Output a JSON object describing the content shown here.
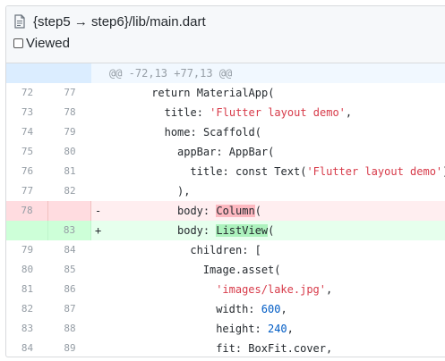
{
  "file": {
    "path": "{step5 → step6}/lib/main.dart",
    "viewed_label": "Viewed"
  },
  "hunk_header": "@@ -72,13 +77,13 @@",
  "lines": [
    {
      "type": "ctx",
      "old": "72",
      "new": "77",
      "sign": "",
      "code": "return MaterialApp(",
      "indent": 6
    },
    {
      "type": "ctx",
      "old": "73",
      "new": "78",
      "sign": "",
      "code": "title: 'Flutter layout demo',",
      "indent": 8
    },
    {
      "type": "ctx",
      "old": "74",
      "new": "79",
      "sign": "",
      "code": "home: Scaffold(",
      "indent": 8
    },
    {
      "type": "ctx",
      "old": "75",
      "new": "80",
      "sign": "",
      "code": "appBar: AppBar(",
      "indent": 10
    },
    {
      "type": "ctx",
      "old": "76",
      "new": "81",
      "sign": "",
      "code": "title: const Text('Flutter layout demo'),",
      "indent": 12
    },
    {
      "type": "ctx",
      "old": "77",
      "new": "82",
      "sign": "",
      "code": "),",
      "indent": 10
    },
    {
      "type": "del",
      "old": "78",
      "new": "",
      "sign": "-",
      "code": "body: Column(",
      "indent": 10
    },
    {
      "type": "add",
      "old": "",
      "new": "83",
      "sign": "+",
      "code": "body: ListView(",
      "indent": 10
    },
    {
      "type": "ctx",
      "old": "79",
      "new": "84",
      "sign": "",
      "code": "children: [",
      "indent": 12
    },
    {
      "type": "ctx",
      "old": "80",
      "new": "85",
      "sign": "",
      "code": "Image.asset(",
      "indent": 14
    },
    {
      "type": "ctx",
      "old": "81",
      "new": "86",
      "sign": "",
      "code": "'images/lake.jpg',",
      "indent": 16
    },
    {
      "type": "ctx",
      "old": "82",
      "new": "87",
      "sign": "",
      "code": "width: 600,",
      "indent": 16
    },
    {
      "type": "ctx",
      "old": "83",
      "new": "88",
      "sign": "",
      "code": "height: 240,",
      "indent": 16
    },
    {
      "type": "ctx",
      "old": "84",
      "new": "89",
      "sign": "",
      "code": "fit: BoxFit.cover,",
      "indent": 16
    }
  ],
  "colors": {
    "deleted_bg": "#ffeef0",
    "added_bg": "#e6ffed",
    "string": "#d73a49",
    "number": "#005cc5"
  }
}
